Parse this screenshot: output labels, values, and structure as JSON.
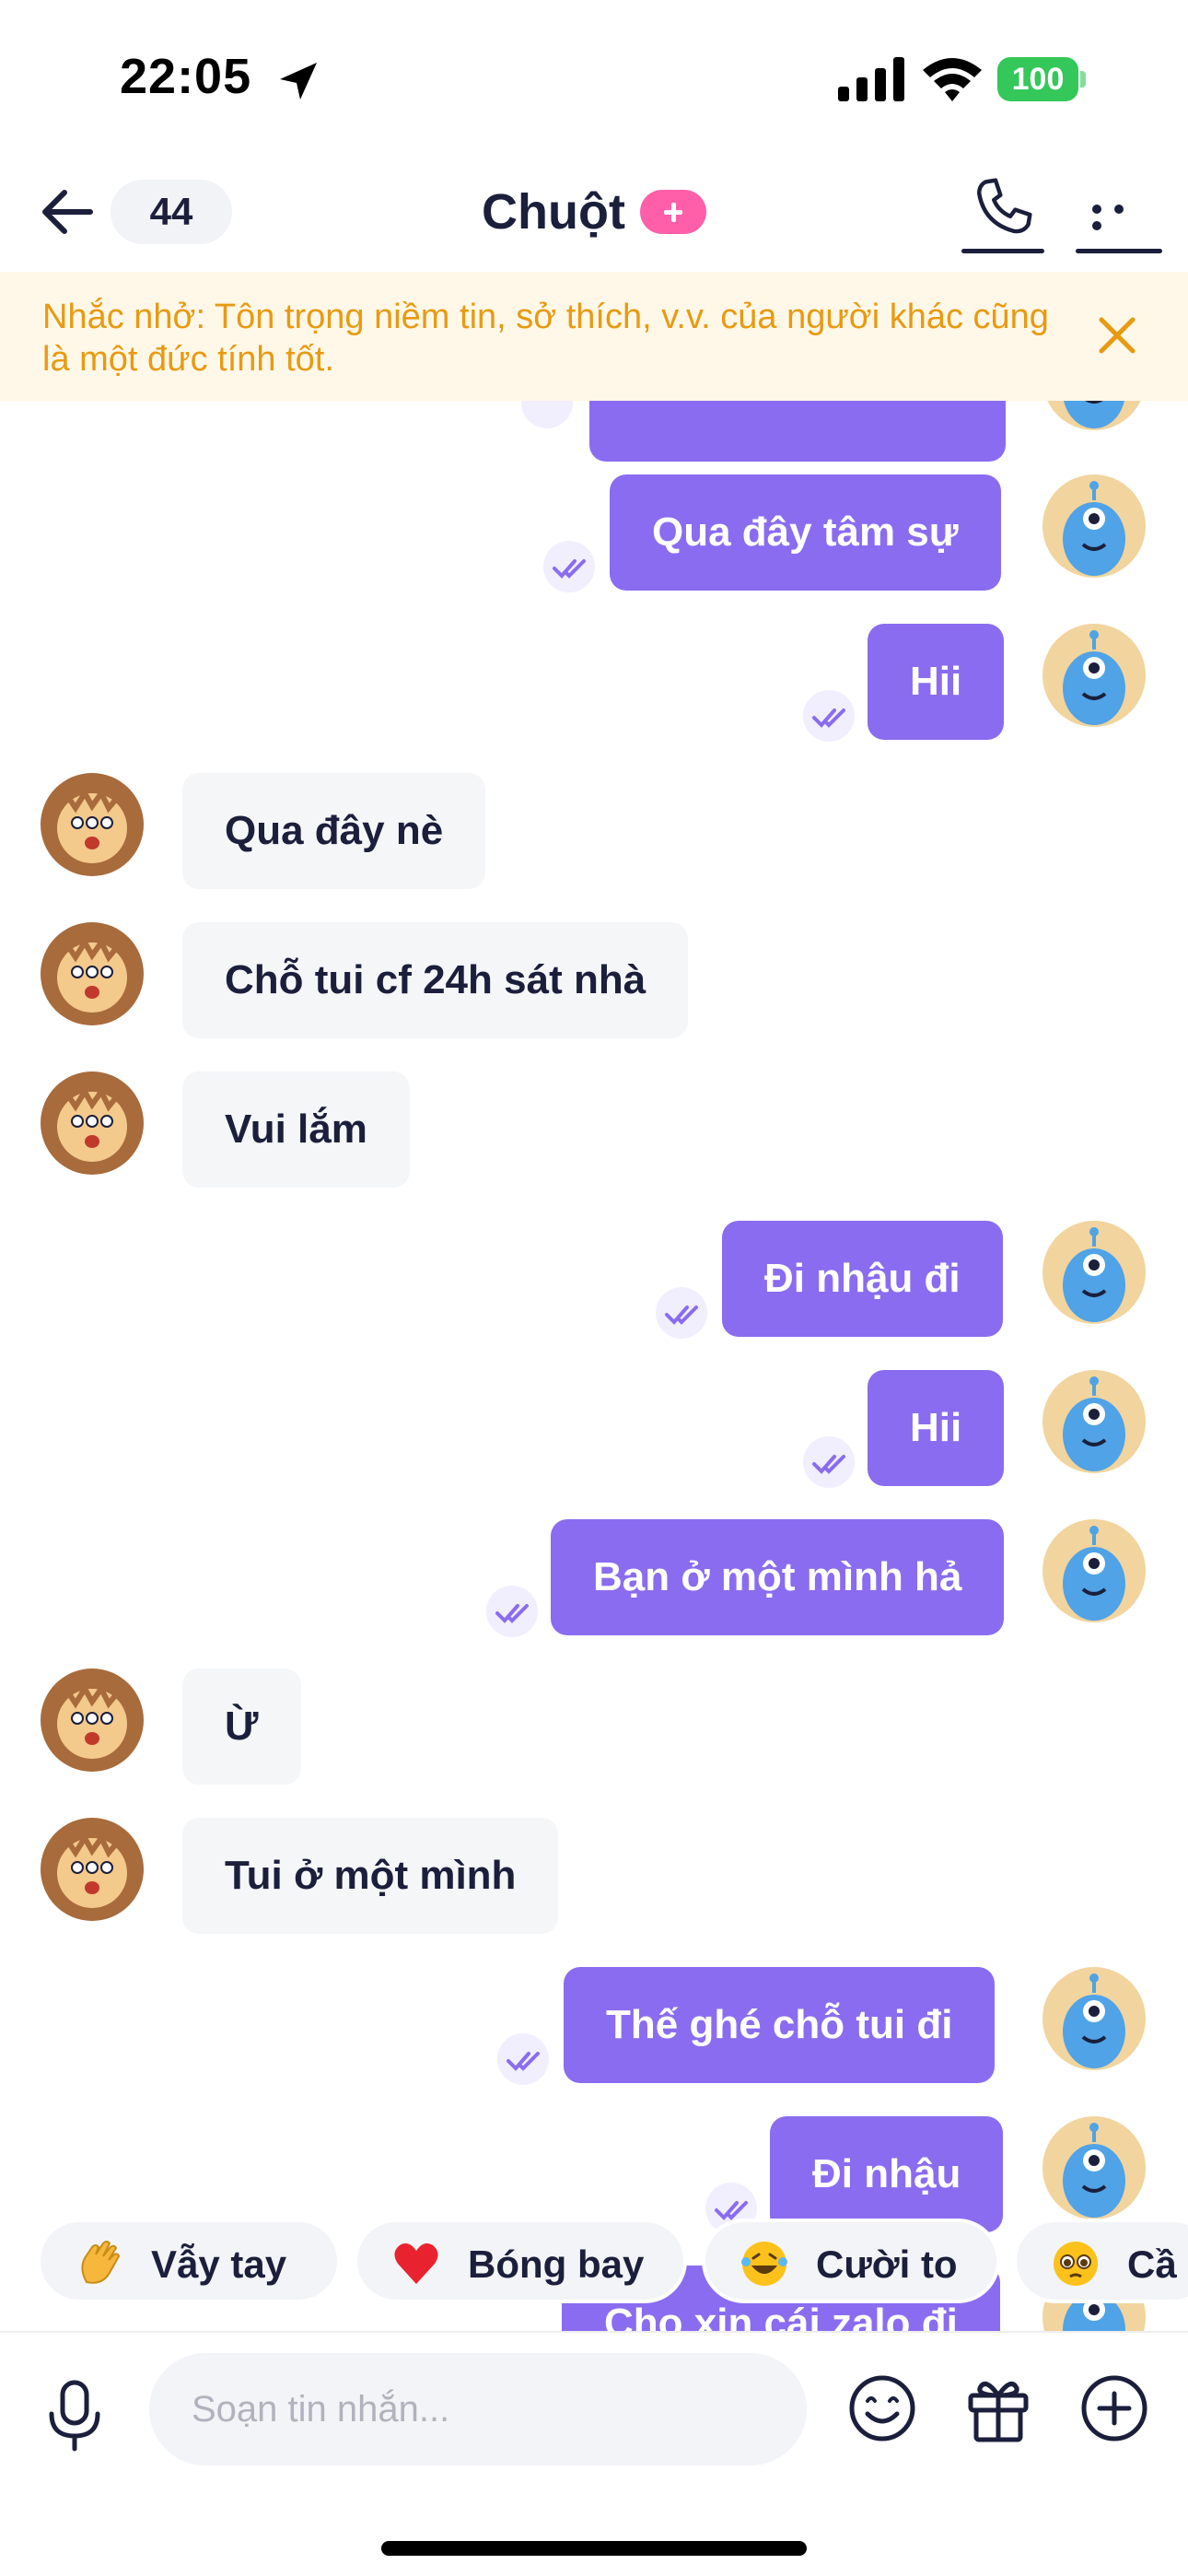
{
  "status_bar": {
    "time": "22:05",
    "battery": "100"
  },
  "header": {
    "back_count": "44",
    "title": "Chuột"
  },
  "reminder": {
    "text": "Nhắc nhở: Tôn trọng niềm tin, sở thích, v.v. của người khác cũng là một đức tính tốt."
  },
  "messages": [
    {
      "direction": "outgoing",
      "text": "Qua đây tâm sự"
    },
    {
      "direction": "outgoing",
      "text": "Hii"
    },
    {
      "direction": "incoming",
      "text": "Qua đây nè"
    },
    {
      "direction": "incoming",
      "text": "Chỗ tui cf 24h sát nhà"
    },
    {
      "direction": "incoming",
      "text": "Vui lắm"
    },
    {
      "direction": "outgoing",
      "text": "Đi nhậu đi"
    },
    {
      "direction": "outgoing",
      "text": "Hii"
    },
    {
      "direction": "outgoing",
      "text": "Bạn ở một mình hả"
    },
    {
      "direction": "incoming",
      "text": "Ừ"
    },
    {
      "direction": "incoming",
      "text": "Tui ở một mình"
    },
    {
      "direction": "outgoing",
      "text": "Thế ghé chỗ tui đi"
    },
    {
      "direction": "outgoing",
      "text": "Đi nhậu"
    },
    {
      "direction": "outgoing",
      "text": "Cho xin cái zalo đi"
    }
  ],
  "quick_reactions": [
    {
      "icon": "waving-hand-icon",
      "label": "Vẫy tay"
    },
    {
      "icon": "red-heart-icon",
      "label": "Bóng bay"
    },
    {
      "icon": "laughing-tears-icon",
      "label": "Cười to"
    },
    {
      "icon": "pleading-face-icon",
      "label": "Cầ"
    }
  ],
  "composer": {
    "placeholder": "Soạn tin nhắn..."
  },
  "colors": {
    "outgoing_bubble": "#8a6cf0",
    "incoming_bubble": "#f5f6f8",
    "reminder_bg": "#fff8e8",
    "reminder_text": "#e89a12",
    "badge_pink": "#ff5fa8"
  }
}
